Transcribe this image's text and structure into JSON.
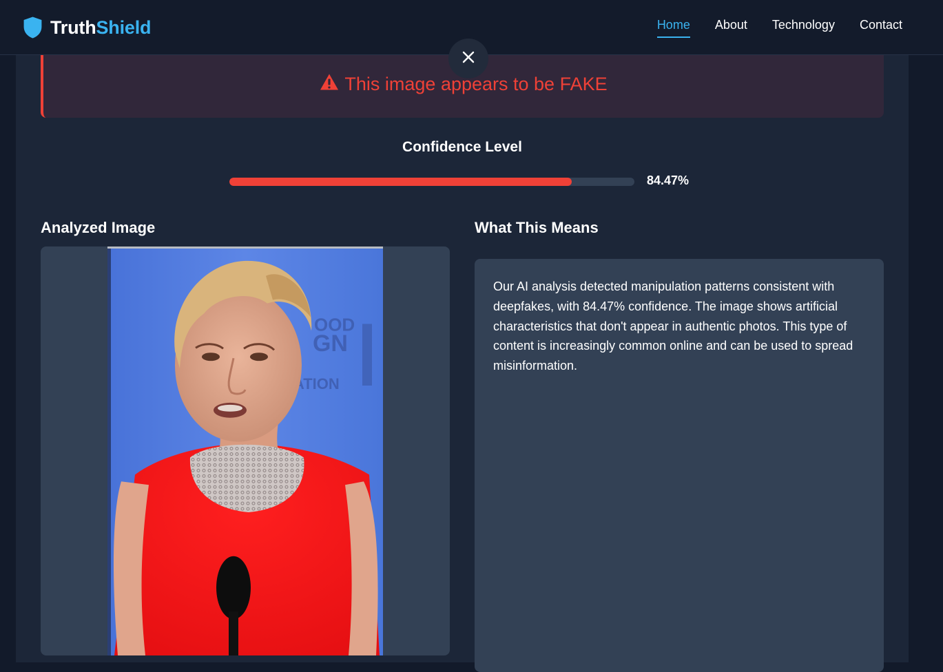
{
  "header": {
    "logo_part1": "Truth",
    "logo_part2": "Shield",
    "nav": [
      {
        "label": "Home",
        "active": true
      },
      {
        "label": "About",
        "active": false
      },
      {
        "label": "Technology",
        "active": false
      },
      {
        "label": "Contact",
        "active": false
      }
    ]
  },
  "result": {
    "alert_text": "This image appears to be FAKE",
    "confidence_title": "Confidence Level",
    "confidence_value": "84.47%",
    "confidence_fraction": 0.8447
  },
  "analyzed": {
    "title": "Analyzed Image"
  },
  "means": {
    "title": "What This Means",
    "body": "Our AI analysis detected manipulation patterns consistent with deepfakes, with 84.47% confidence. The image shows artificial characteristics that don't appear in authentic photos. This type of content is increasingly common online and can be used to spread misinformation."
  },
  "colors": {
    "accent": "#3ab3f0",
    "danger": "#ef4137",
    "background": "#121a2a",
    "card": "#1c2638",
    "panel": "#334155"
  },
  "icons": {
    "logo": "shield-icon",
    "alert": "warning-triangle-icon",
    "close": "close-icon"
  }
}
